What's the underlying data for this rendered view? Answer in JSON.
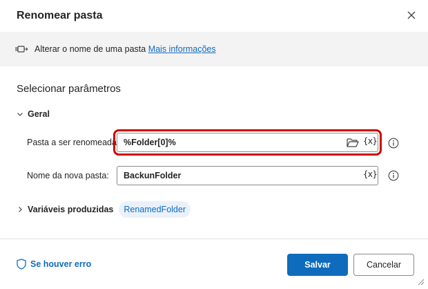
{
  "dialog": {
    "title": "Renomear pasta",
    "close_icon": "close-icon"
  },
  "info": {
    "icon": "action-icon",
    "text": "Alterar o nome de uma pasta",
    "link": "Mais informações"
  },
  "section": {
    "title": "Selecionar parâmetros"
  },
  "group": {
    "label": "Geral",
    "expanded": true
  },
  "fields": [
    {
      "label": "Pasta a ser renomeada:",
      "value": "%Folder[0]%",
      "var_label": "{x}",
      "has_folder_picker": true,
      "highlighted": true,
      "highlight_color": "#d10000"
    },
    {
      "label": "Nome da nova pasta:",
      "value": "BackunFolder",
      "var_label": "{x}",
      "has_folder_picker": false
    }
  ],
  "produced": {
    "label": "Variáveis produzidas",
    "variable": "RenamedFolder",
    "expanded": false
  },
  "footer": {
    "on_error_label": "Se houver erro",
    "save_label": "Salvar",
    "cancel_label": "Cancelar"
  },
  "colors": {
    "accent": "#0f6cbd",
    "pill_bg": "#eaf1fb",
    "infobar_bg": "#f3f3f3",
    "highlight": "#d10000"
  }
}
